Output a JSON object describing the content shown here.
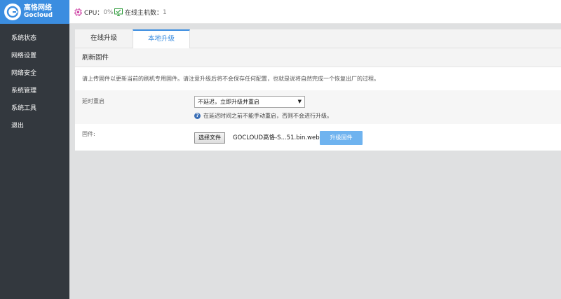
{
  "header": {
    "logo_cn": "高恪网络",
    "logo_en": "Gocloud",
    "cpu_label": "CPU：",
    "cpu_value": "0%",
    "hosts_label": "在线主机数：",
    "hosts_value": "1"
  },
  "sidebar": {
    "items": [
      {
        "label": "系统状态"
      },
      {
        "label": "网络设置"
      },
      {
        "label": "网络安全"
      },
      {
        "label": "系统管理"
      },
      {
        "label": "系统工具"
      },
      {
        "label": "退出"
      }
    ]
  },
  "tabs": [
    {
      "label": "在线升级"
    },
    {
      "label": "本地升级"
    }
  ],
  "panel": {
    "title": "刷新固件",
    "notice": "请上传固件以更新当前的刷机专用固件。请注意升级后将不会保存任何配置，也就是说将自然完成一个恢复出厂的过程。",
    "delay_label": "延时重启",
    "delay_select_value": "不延迟，立即升级并重启",
    "delay_hint": "在延迟时间之前不能手动重启，否则不会进行升级。",
    "firmware_label": "固件:",
    "choose_file_label": "选择文件",
    "file_name": "GOCLOUD高恪-S...51.bin.web",
    "upgrade_button": "升级固件"
  },
  "colors": {
    "accent": "#3b8de0",
    "sidebar_bg": "#33383e",
    "upgrade_button_bg": "#6fb3ef"
  }
}
